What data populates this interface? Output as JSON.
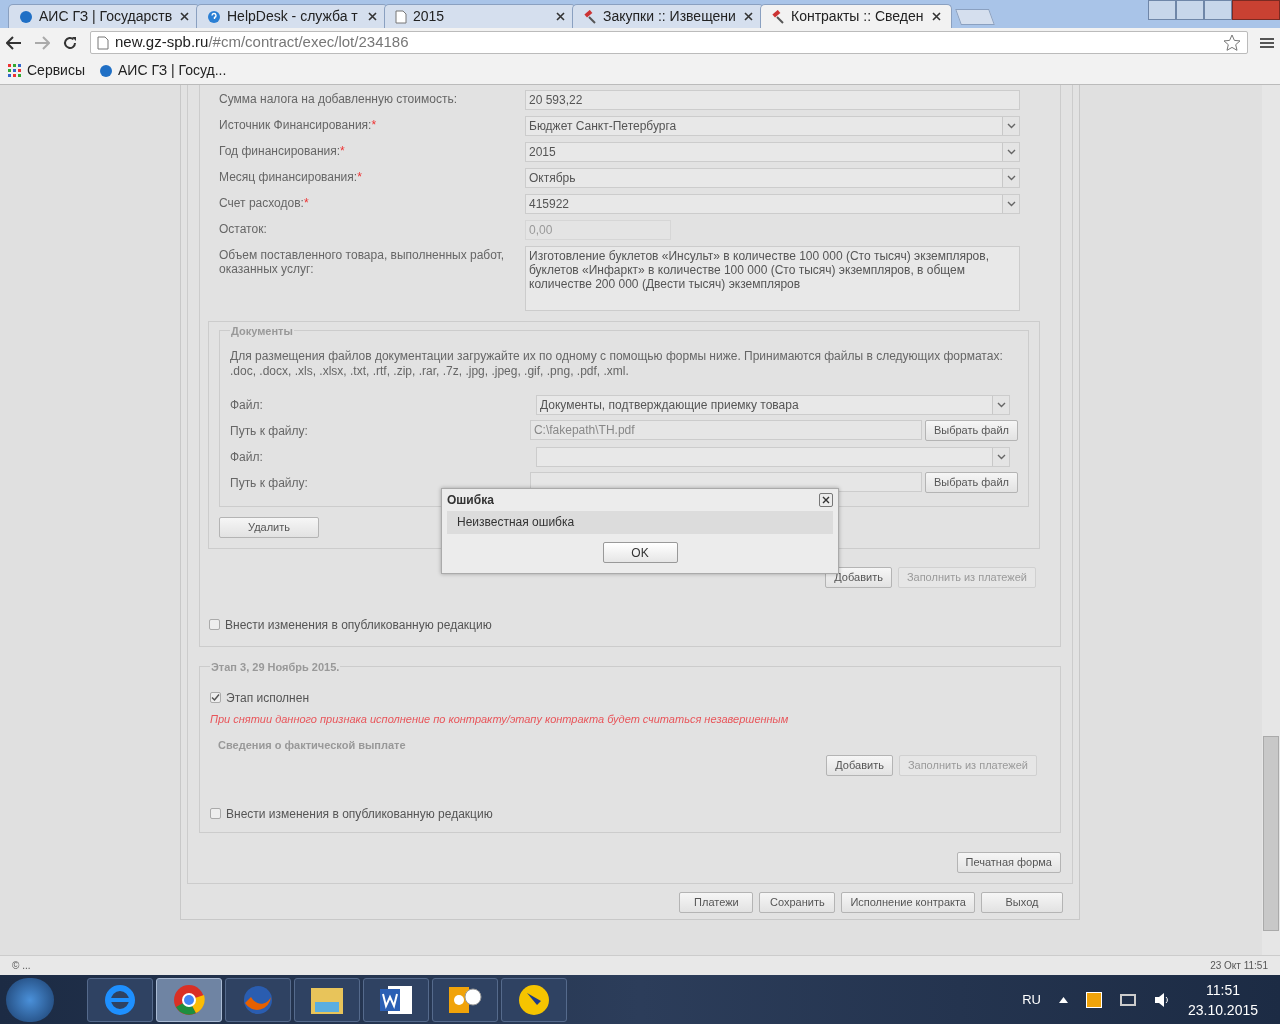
{
  "browser": {
    "tabs": [
      {
        "title": "АИС ГЗ | Государств",
        "kind": "gz",
        "selected": false
      },
      {
        "title": "HelpDesk - служба т",
        "kind": "help",
        "selected": false
      },
      {
        "title": "2015",
        "kind": "page",
        "selected": false
      },
      {
        "title": "Закупки :: Извещени",
        "kind": "gavel",
        "selected": false
      },
      {
        "title": "Контракты :: Сведен",
        "kind": "gavel",
        "selected": true
      }
    ],
    "address_host": "new.gz-spb.ru",
    "address_path": "/#cm/contract/exec/lot/234186",
    "bookmarks": [
      {
        "label": "Сервисы",
        "kind": "apps"
      },
      {
        "label": "АИС ГЗ | Госуд...",
        "kind": "gz"
      }
    ]
  },
  "form": {
    "fields": [
      {
        "label": "Сумма налога на добавленную стоимость:",
        "kind": "text",
        "value": "20 593,22"
      },
      {
        "label": "Источник Финансирования:",
        "required_mark": "*",
        "kind": "select",
        "value": "Бюджет Санкт-Петербурга"
      },
      {
        "label": "Год финансирования:",
        "required_mark": "*",
        "kind": "select",
        "value": "2015"
      },
      {
        "label": "Месяц финансирования:",
        "required_mark": "*",
        "kind": "select",
        "value": "Октябрь"
      },
      {
        "label": "Счет расходов:",
        "required_mark": "*",
        "kind": "select",
        "value": "415922"
      },
      {
        "label": "Остаток:",
        "kind": "disabled",
        "value": "0,00"
      },
      {
        "label": "Объем поставленного товара, выполненных работ, оказанных услуг:",
        "kind": "textarea",
        "value": "Изготовление буклетов «Инсульт» в  количестве 100 000 (Сто тысяч) экземпляров, буклетов «Инфаркт» в  количестве 100 000 (Сто тысяч) экземпляров, в общем количестве 200 000 (Двести тысяч) экземпляров"
      }
    ],
    "documents": {
      "legend": "Документы",
      "note": "Для размещения файлов документации загружайте их по одному с помощью формы ниже. Принимаются файлы в следующих форматах: .doc, .docx, .xls, .xlsx, .txt, .rtf, .zip, .rar, .7z, .jpg, .jpeg, .gif, .png, .pdf, .xml.",
      "rows": [
        {
          "kind": "select",
          "label": "Файл:",
          "value": "Документы, подтверждающие приемку товара"
        },
        {
          "kind": "path",
          "label": "Путь к файлу:",
          "value": "C:\\fakepath\\TH.pdf",
          "button": "Выбрать файл"
        },
        {
          "kind": "select",
          "label": "Файл:",
          "value": ""
        },
        {
          "kind": "path",
          "label": "Путь к файлу:",
          "value": "",
          "button": "Выбрать файл"
        }
      ],
      "delete": "Удалить"
    },
    "buttons": [
      {
        "label": "Добавить",
        "disabled": false
      },
      {
        "label": "Заполнить из платежей",
        "disabled": true
      }
    ],
    "publish": {
      "label": "Внести изменения в опубликованную редакцию",
      "checked": false
    }
  },
  "stage3": {
    "legend": "Этап 3, 29 Ноябрь 2015.",
    "done": {
      "label": "Этап исполнен",
      "checked": true
    },
    "warning": "При снятии данного признака исполнение по контракту/этапу контракта будет считаться незавершенным",
    "payment_title": "Сведения о фактической выплате",
    "buttons": [
      {
        "label": "Добавить",
        "disabled": false
      },
      {
        "label": "Заполнить из платежей",
        "disabled": true
      }
    ],
    "publish": {
      "label": "Внести изменения в опубликованную редакцию",
      "checked": false
    }
  },
  "print_button": "Печатная форма",
  "footer_buttons": [
    "Платежи",
    "Сохранить",
    "Исполнение контракта",
    "Выход"
  ],
  "dialog": {
    "title": "Ошибка",
    "message": "Неизвестная ошибка",
    "ok": "OK"
  },
  "status_bar": {
    "left": "© ...",
    "right": "23 Окт 11:51"
  },
  "taskbar": {
    "apps": [
      {
        "kind": "ie",
        "selected": false
      },
      {
        "kind": "chrome",
        "selected": true
      },
      {
        "kind": "firefox",
        "selected": false
      },
      {
        "kind": "explorer",
        "selected": false
      },
      {
        "kind": "word",
        "selected": false
      },
      {
        "kind": "outlook",
        "selected": false
      },
      {
        "kind": "pen",
        "selected": false
      }
    ],
    "lang": "RU",
    "time": "11:51",
    "date": "23.10.2015"
  }
}
